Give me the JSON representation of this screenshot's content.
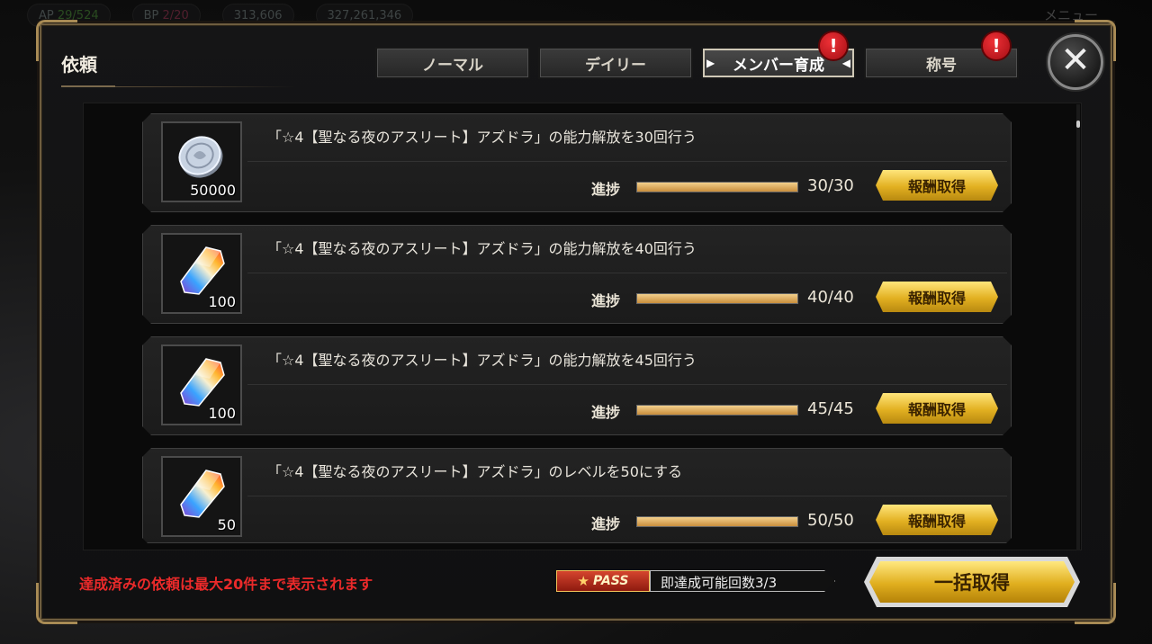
{
  "background": {
    "pills": [
      {
        "label": "AP",
        "value": "29/524"
      },
      {
        "label": "BP",
        "value": "2/20"
      },
      {
        "label": "",
        "value": "313,606"
      },
      {
        "label": "",
        "value": "327,261,346"
      }
    ],
    "menu_label": "メニュー"
  },
  "modal": {
    "title": "依頼",
    "tabs": [
      {
        "label": "ノーマル",
        "active": false,
        "alert": false
      },
      {
        "label": "デイリー",
        "active": false,
        "alert": false
      },
      {
        "label": "メンバー育成",
        "active": true,
        "alert": true
      },
      {
        "label": "称号",
        "active": false,
        "alert": true
      }
    ],
    "alert_glyph": "!",
    "close_glyph": "✕",
    "side_buttons": [
      {
        "icon": "knight-helmet-icon",
        "glyph": "♞"
      },
      {
        "icon": "refresh-icon",
        "glyph": "↻"
      }
    ]
  },
  "quests": [
    {
      "reward_icon": "coin-icon",
      "reward_qty": "50000",
      "text": "「☆4【聖なる夜のアスリート】アズドラ」の能力解放を30回行う",
      "progress_label": "進捗",
      "progress": 1.0,
      "count": "30/30",
      "button": "報酬取得"
    },
    {
      "reward_icon": "rainbow-crystal-icon",
      "reward_qty": "100",
      "text": "「☆4【聖なる夜のアスリート】アズドラ」の能力解放を40回行う",
      "progress_label": "進捗",
      "progress": 1.0,
      "count": "40/40",
      "button": "報酬取得"
    },
    {
      "reward_icon": "rainbow-crystal-icon",
      "reward_qty": "100",
      "text": "「☆4【聖なる夜のアスリート】アズドラ」の能力解放を45回行う",
      "progress_label": "進捗",
      "progress": 1.0,
      "count": "45/45",
      "button": "報酬取得"
    },
    {
      "reward_icon": "rainbow-crystal-icon",
      "reward_qty": "50",
      "text": "「☆4【聖なる夜のアスリート】アズドラ」のレベルを50にする",
      "progress_label": "進捗",
      "progress": 1.0,
      "count": "50/50",
      "button": "報酬取得"
    }
  ],
  "footer": {
    "notice": "達成済みの依頼は最大20件まで表示されます",
    "pass_label": "PASS",
    "pass_text": "即達成可能回数3/3",
    "claim_all": "一括取得"
  },
  "colors": {
    "gold": "#e2b021",
    "notice_red": "#ea2a2a",
    "alert_red": "#d41f26"
  }
}
